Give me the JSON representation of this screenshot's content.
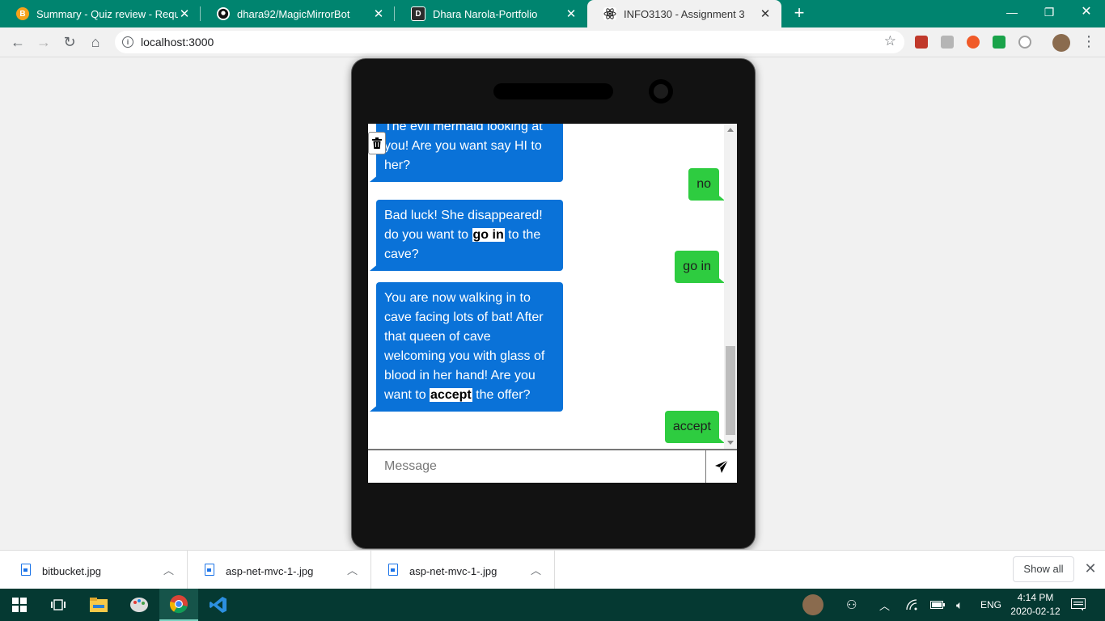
{
  "browser": {
    "tabs": [
      {
        "title": "Summary - Quiz review - Require",
        "icon": "brightspace-icon",
        "color": "#f6a21a"
      },
      {
        "title": "dhara92/MagicMirrorBot",
        "icon": "github-icon",
        "color": "#000000"
      },
      {
        "title": "Dhara Narola-Portfolio",
        "icon": "d-logo-icon",
        "color": "#2b2b2b"
      },
      {
        "title": "INFO3130 - Assignment 3",
        "icon": "react-icon",
        "color": "#61dafb"
      }
    ],
    "url": "localhost:3000",
    "accent_color": "#00846f"
  },
  "chat": {
    "messages": [
      {
        "from": "bot",
        "parts": [
          "The evil mermaid looking at you! Are you want say HI to her?"
        ]
      },
      {
        "from": "user",
        "text": "no"
      },
      {
        "from": "bot",
        "parts": [
          "Bad luck! She disappeared! do you want to ",
          "go in",
          " to the cave?"
        ]
      },
      {
        "from": "user",
        "text": "go in"
      },
      {
        "from": "bot",
        "parts": [
          "You are now walking in to cave facing lots of bat! After that queen of cave welcoming you with glass of blood in her hand! Are you want to ",
          "accept",
          " the offer?"
        ]
      },
      {
        "from": "user",
        "text": "accept"
      }
    ],
    "input_placeholder": "Message",
    "bot_color": "#0a72d8",
    "user_color": "#2ecc40"
  },
  "downloads": {
    "items": [
      {
        "name": "bitbucket.jpg"
      },
      {
        "name": "asp-net-mvc-1-.jpg"
      },
      {
        "name": "asp-net-mvc-1-.jpg"
      }
    ],
    "show_all_label": "Show all"
  },
  "taskbar": {
    "language": "ENG",
    "time": "4:14 PM",
    "date": "2020-02-12"
  }
}
